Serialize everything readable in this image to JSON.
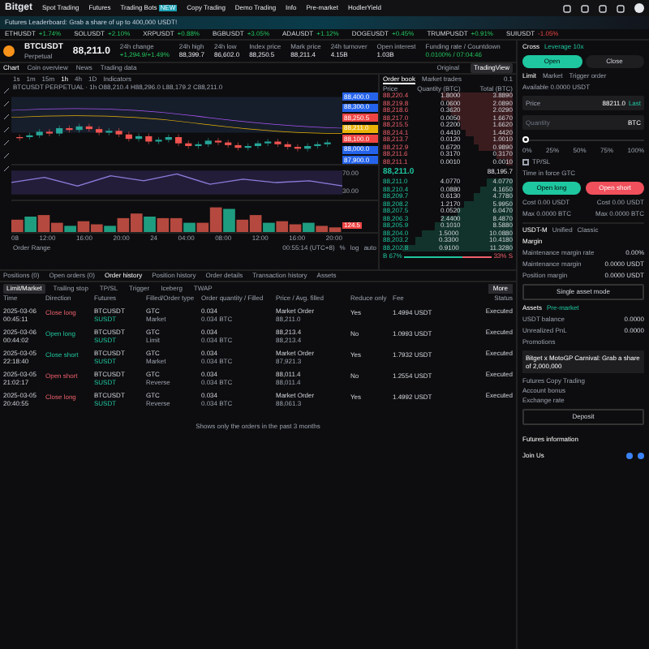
{
  "nav": {
    "logo": "Bitget",
    "items": [
      {
        "label": "Spot Trading"
      },
      {
        "label": "Futures"
      },
      {
        "label": "Trading Bots",
        "badge": "NEW"
      },
      {
        "label": "Copy Trading"
      },
      {
        "label": "Demo Trading"
      },
      {
        "label": "Info"
      },
      {
        "label": "Pre-market"
      },
      {
        "label": "HodlerYield"
      }
    ]
  },
  "banner": "Futures Leaderboard: Grab a share of up to 400,000 USDT!",
  "ticker": [
    {
      "symbol": "ETHUSDT",
      "change": "+1.74%",
      "rising": true
    },
    {
      "symbol": "SOLUSDT",
      "change": "+2.10%",
      "rising": true
    },
    {
      "symbol": "XRPUSDT",
      "change": "+0.88%",
      "rising": true
    },
    {
      "symbol": "BGBUSDT",
      "change": "+3.05%",
      "rising": true
    },
    {
      "symbol": "ADAUSDT",
      "change": "+1.12%",
      "rising": true
    },
    {
      "symbol": "DOGEUSDT",
      "change": "+0.45%",
      "rising": true
    },
    {
      "symbol": "TRUMPUSDT",
      "change": "+0.91%",
      "rising": true
    },
    {
      "symbol": "SUIUSDT",
      "change": "-1.05%",
      "rising": false
    }
  ],
  "symbol": {
    "name": "BTCUSDT",
    "type": "Perpetual",
    "price": "88,211.0",
    "stats": [
      {
        "label": "24h change",
        "value": "+1,294.9/+1.49%",
        "kind": "up"
      },
      {
        "label": "24h high",
        "value": "88,399.7",
        "kind": "plain"
      },
      {
        "label": "24h low",
        "value": "86,602.0",
        "kind": "plain"
      },
      {
        "label": "Index price",
        "value": "88,250.5",
        "kind": "plain"
      },
      {
        "label": "Mark price",
        "value": "88,211.4",
        "kind": "plain"
      },
      {
        "label": "24h turnover",
        "value": "4.15B",
        "kind": "plain"
      },
      {
        "label": "Open interest",
        "value": "1.03B",
        "kind": "plain"
      },
      {
        "label": "Funding rate / Countdown",
        "value": "0.0100% / 07:04:46",
        "kind": "up"
      }
    ]
  },
  "chart_tabs": [
    {
      "label": "Chart",
      "selected": true
    },
    {
      "label": "Coin overview",
      "selected": false
    },
    {
      "label": "News",
      "selected": false
    },
    {
      "label": "Trading data",
      "selected": false
    }
  ],
  "view_tabs": [
    {
      "label": "Original",
      "selected": false
    },
    {
      "label": "TradingView",
      "selected": true
    }
  ],
  "intervals": [
    {
      "label": "1s",
      "selected": false
    },
    {
      "label": "1m",
      "selected": false
    },
    {
      "label": "15m",
      "selected": false
    },
    {
      "label": "1h",
      "selected": true
    },
    {
      "label": "4h",
      "selected": false
    },
    {
      "label": "1D",
      "selected": false
    }
  ],
  "indicators": "Indicators",
  "legend": "BTCUSDT PERPETUAL · 1h  O88,210.4 H88,296.0 L88,179.2 C88,211.0",
  "price_tags": [
    {
      "label": "88,400.0",
      "color": "#2563eb"
    },
    {
      "label": "88,300.0",
      "color": "#2563eb"
    },
    {
      "label": "88,250.5",
      "color": "#ef4444"
    },
    {
      "label": "88,211.0",
      "color": "#eab308"
    },
    {
      "label": "88,100.0",
      "color": "#ef4444"
    },
    {
      "label": "88,000.0",
      "color": "#2563eb"
    },
    {
      "label": "87,900.0",
      "color": "#2563eb"
    }
  ],
  "rsi_labels": [
    "70.00",
    "30.00"
  ],
  "volume_tag": "124.5",
  "time_labels": [
    "08",
    "12:00",
    "16:00",
    "20:00",
    "24",
    "04:00",
    "08:00",
    "12:00",
    "16:00",
    "20:00"
  ],
  "chart_footer": {
    "range": "Order Range",
    "time": "00:55:14 (UTC+8)",
    "options": [
      "%",
      "log",
      "auto"
    ]
  },
  "order_book": {
    "tabs": [
      {
        "label": "Order book",
        "selected": true
      },
      {
        "label": "Market trades",
        "selected": false
      }
    ],
    "step": "0.1",
    "columns": [
      "Price",
      "Quantity (BTC)",
      "Total (BTC)"
    ],
    "asks": [
      {
        "price": "88,220.4",
        "qty": "1.8000",
        "total": "3.8890"
      },
      {
        "price": "88,219.8",
        "qty": "0.0600",
        "total": "2.0890"
      },
      {
        "price": "88,218.6",
        "qty": "0.3620",
        "total": "2.0290"
      },
      {
        "price": "88,217.0",
        "qty": "0.0050",
        "total": "1.6670"
      },
      {
        "price": "88,215.5",
        "qty": "0.2200",
        "total": "1.6620"
      },
      {
        "price": "88,214.1",
        "qty": "0.4410",
        "total": "1.4420"
      },
      {
        "price": "88,213.7",
        "qty": "0.0120",
        "total": "1.0010"
      },
      {
        "price": "88,212.9",
        "qty": "0.6720",
        "total": "0.9890"
      },
      {
        "price": "88,211.6",
        "qty": "0.3170",
        "total": "0.3170"
      },
      {
        "price": "88,211.1",
        "qty": "0.0010",
        "total": "0.0010"
      }
    ],
    "last": "88,211.0",
    "mark": "88,195.7",
    "bids": [
      {
        "price": "88,211.0",
        "qty": "4.0770",
        "total": "4.0770"
      },
      {
        "price": "88,210.4",
        "qty": "0.0880",
        "total": "4.1650"
      },
      {
        "price": "88,209.7",
        "qty": "0.6130",
        "total": "4.7780"
      },
      {
        "price": "88,208.2",
        "qty": "1.2170",
        "total": "5.9950"
      },
      {
        "price": "88,207.5",
        "qty": "0.0520",
        "total": "6.0470"
      },
      {
        "price": "88,206.3",
        "qty": "2.4400",
        "total": "8.4870"
      },
      {
        "price": "88,205.9",
        "qty": "0.1010",
        "total": "8.5880"
      },
      {
        "price": "88,204.0",
        "qty": "1.5000",
        "total": "10.0880"
      },
      {
        "price": "88,203.2",
        "qty": "0.3300",
        "total": "10.4180"
      },
      {
        "price": "88,202.8",
        "qty": "0.9100",
        "total": "11.3280"
      }
    ],
    "buy_ratio": "B 67%",
    "sell_ratio": "33% S",
    "ratio_bar": {
      "level": 0.67
    }
  },
  "bottom_tabs": [
    {
      "label": "Positions (0)",
      "selected": false
    },
    {
      "label": "Open orders (0)",
      "selected": false
    },
    {
      "label": "Order history",
      "selected": true
    },
    {
      "label": "Position history",
      "selected": false
    },
    {
      "label": "Order details",
      "selected": false
    },
    {
      "label": "Transaction history",
      "selected": false
    },
    {
      "label": "Assets",
      "selected": false
    }
  ],
  "sub_tabs": [
    {
      "label": "Limit/Market",
      "selected": true
    },
    {
      "label": "Trailing stop",
      "selected": false
    },
    {
      "label": "TP/SL",
      "selected": false
    },
    {
      "label": "Trigger",
      "selected": false
    },
    {
      "label": "Iceberg",
      "selected": false
    },
    {
      "label": "TWAP",
      "selected": false
    }
  ],
  "more": "More",
  "table": {
    "columns": [
      "Time",
      "Direction",
      "Futures",
      "Filled/Order type",
      "Order quantity / Filled",
      "Price / Avg. filled",
      "Reduce only",
      "Fee",
      "Status"
    ],
    "rows": [
      {
        "date": "2025-03-06",
        "time": "00:45:11",
        "direction": "Close long",
        "buy": false,
        "futures": "BTCUSDT",
        "tag": "SUSDT",
        "type": "GTC",
        "type2": "Market",
        "qty": "0.034",
        "qty2": "0.034 BTC",
        "price": "Market Order",
        "price2": "88,211.0",
        "reduce": "Yes",
        "fee": "1.4994 USDT",
        "status": "Executed"
      },
      {
        "date": "2025-03-06",
        "time": "00:44:02",
        "direction": "Open long",
        "buy": true,
        "futures": "BTCUSDT",
        "tag": "SUSDT",
        "type": "GTC",
        "type2": "Limit",
        "qty": "0.034",
        "qty2": "0.034 BTC",
        "price": "88,213.4",
        "price2": "88,213.4",
        "reduce": "No",
        "fee": "1.0993 USDT",
        "status": "Executed"
      },
      {
        "date": "2025-03-05",
        "time": "22:18:40",
        "direction": "Close short",
        "buy": true,
        "futures": "BTCUSDT",
        "tag": "SUSDT",
        "type": "GTC",
        "type2": "Market",
        "qty": "0.034",
        "qty2": "0.034 BTC",
        "price": "Market Order",
        "price2": "87,921.3",
        "reduce": "Yes",
        "fee": "1.7932 USDT",
        "status": "Executed"
      },
      {
        "date": "2025-03-05",
        "time": "21:02:17",
        "direction": "Open short",
        "buy": false,
        "futures": "BTCUSDT",
        "tag": "SUSDT",
        "type": "GTC",
        "type2": "Reverse",
        "qty": "0.034",
        "qty2": "0.034 BTC",
        "price": "88,011.4",
        "price2": "88,011.4",
        "reduce": "No",
        "fee": "1.2554 USDT",
        "status": "Executed"
      },
      {
        "date": "2025-03-05",
        "time": "20:40:55",
        "direction": "Close long",
        "buy": false,
        "futures": "BTCUSDT",
        "tag": "SUSDT",
        "type": "GTC",
        "type2": "Reverse",
        "qty": "0.034",
        "qty2": "0.034 BTC",
        "price": "Market Order",
        "price2": "88,061.3",
        "reduce": "Yes",
        "fee": "1.4992 USDT",
        "status": "Executed"
      }
    ]
  },
  "table_note": "Shows only the orders in the past 3 months",
  "trade": {
    "margin_mode": "Cross",
    "leverage": "Leverage 10x",
    "sides": [
      {
        "label": "Open",
        "selected": true
      },
      {
        "label": "Close",
        "selected": false
      }
    ],
    "order_types": [
      {
        "label": "Limit",
        "selected": true
      },
      {
        "label": "Market",
        "selected": false
      },
      {
        "label": "Trigger order",
        "selected": false
      }
    ],
    "available": "Available 0.0000 USDT",
    "price_label": "Price",
    "price": "88211.0",
    "price_suffix": "Last",
    "qty_placeholder": "Quantity",
    "qty_unit": "BTC",
    "slider": {
      "level": 0
    },
    "slider_marks": [
      "0%",
      "25%",
      "50%",
      "75%",
      "100%"
    ],
    "tpsl": {
      "label": "TP/SL",
      "checked": false
    },
    "tif": "Time in force GTC",
    "long": "Open long",
    "short": "Open short",
    "costs": [
      {
        "left": "Cost 0.00 USDT",
        "right": "Cost 0.00 USDT"
      },
      {
        "left": "Max 0.0000 BTC",
        "right": "Max 0.0000 BTC"
      }
    ]
  },
  "account": {
    "modes": [
      {
        "label": "USDT-M",
        "selected": true
      },
      {
        "label": "Unified",
        "selected": false
      },
      {
        "label": "Classic",
        "selected": false
      }
    ],
    "margin_title": "Margin",
    "margin_rows": [
      {
        "label": "Maintenance margin rate",
        "value": "0.00%"
      },
      {
        "label": "Maintenance margin",
        "value": "0.0000 USDT"
      },
      {
        "label": "Position margin",
        "value": "0.0000 USDT"
      }
    ],
    "asset_mode": "Single asset mode",
    "assets_title": "Assets",
    "assets_link": "Pre-market",
    "asset_rows": [
      {
        "label": "USDT balance",
        "value": "0.0000"
      },
      {
        "label": "Unrealized PnL",
        "value": "0.0000"
      }
    ],
    "promo_title": "Promotions",
    "promo": "Bitget x MotoGP Carnival: Grab a share of 2,000,000",
    "links": [
      "Futures Copy Trading",
      "Account bonus",
      "Exchange rate"
    ],
    "deposit": "Deposit",
    "info": "Futures information",
    "join": "Join Us"
  }
}
